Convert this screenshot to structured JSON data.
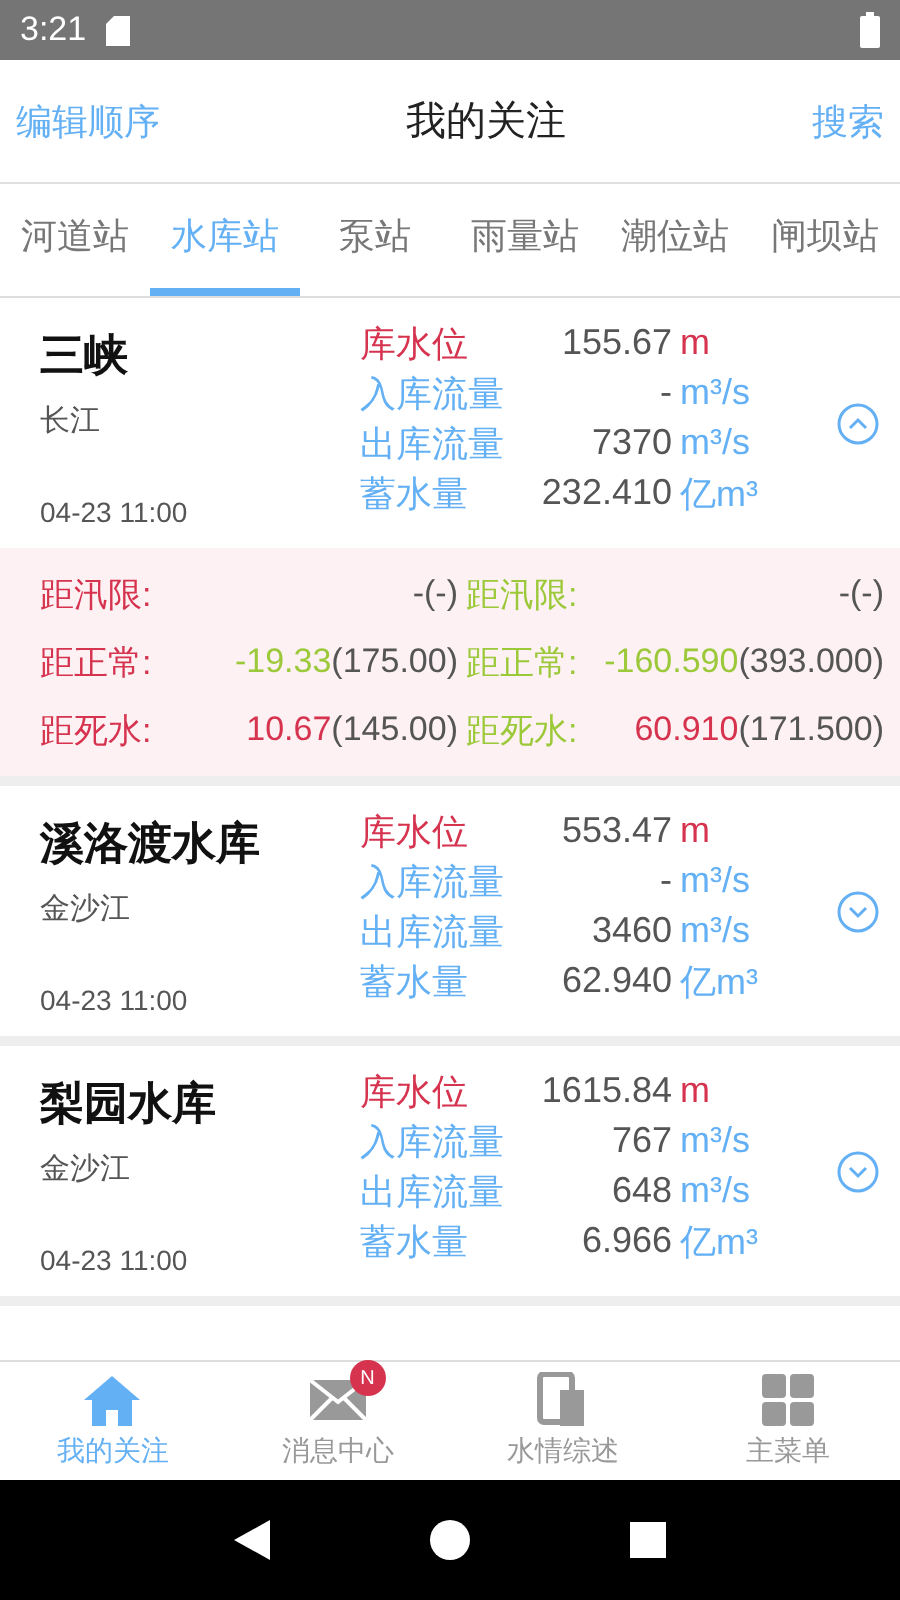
{
  "status_bar": {
    "time": "3:21"
  },
  "header": {
    "left_action": "编辑顺序",
    "title": "我的关注",
    "right_action": "搜索"
  },
  "tabs": [
    {
      "label": "河道站",
      "selected": false
    },
    {
      "label": "水库站",
      "selected": true
    },
    {
      "label": "泵站",
      "selected": false
    },
    {
      "label": "雨量站",
      "selected": false
    },
    {
      "label": "潮位站",
      "selected": false
    },
    {
      "label": "闸坝站",
      "selected": false
    }
  ],
  "stations": [
    {
      "name": "三峡",
      "river": "长江",
      "time": "04-23 11:00",
      "expanded": true,
      "metrics": [
        {
          "kind": "level",
          "label": "库水位",
          "value": "155.67",
          "unit": "m"
        },
        {
          "kind": "flow",
          "label": "入库流量",
          "value": "-",
          "unit": "m³/s"
        },
        {
          "kind": "flow",
          "label": "出库流量",
          "value": "7370",
          "unit": "m³/s"
        },
        {
          "kind": "storage",
          "label": "蓄水量",
          "value": "232.410",
          "unit": "亿m³"
        }
      ],
      "details": [
        {
          "color": "#d6334f",
          "rows": [
            {
              "label": "距汛限:",
              "value": "-",
              "color": "#555555",
              "ref": "(-)"
            },
            {
              "label": "距正常:",
              "value": "-19.33",
              "color": "#9cc93a",
              "ref": "(175.00)"
            },
            {
              "label": "距死水:",
              "value": "10.67",
              "color": "#d6334f",
              "ref": "(145.00)"
            }
          ]
        },
        {
          "color": "#9cc93a",
          "rows": [
            {
              "label": "距汛限:",
              "value": "-",
              "color": "#555555",
              "ref": "(-)"
            },
            {
              "label": "距正常:",
              "value": "-160.590",
              "color": "#9cc93a",
              "ref": "(393.000)"
            },
            {
              "label": "距死水:",
              "value": "60.910",
              "color": "#d6334f",
              "ref": "(171.500)"
            }
          ]
        }
      ]
    },
    {
      "name": "溪洛渡水库",
      "river": "金沙江",
      "time": "04-23 11:00",
      "expanded": false,
      "metrics": [
        {
          "kind": "level",
          "label": "库水位",
          "value": "553.47",
          "unit": "m"
        },
        {
          "kind": "flow",
          "label": "入库流量",
          "value": "-",
          "unit": "m³/s"
        },
        {
          "kind": "flow",
          "label": "出库流量",
          "value": "3460",
          "unit": "m³/s"
        },
        {
          "kind": "storage",
          "label": "蓄水量",
          "value": "62.940",
          "unit": "亿m³"
        }
      ]
    },
    {
      "name": "梨园水库",
      "river": "金沙江",
      "time": "04-23 11:00",
      "expanded": false,
      "metrics": [
        {
          "kind": "level",
          "label": "库水位",
          "value": "1615.84",
          "unit": "m"
        },
        {
          "kind": "flow",
          "label": "入库流量",
          "value": "767",
          "unit": "m³/s"
        },
        {
          "kind": "flow",
          "label": "出库流量",
          "value": "648",
          "unit": "m³/s"
        },
        {
          "kind": "storage",
          "label": "蓄水量",
          "value": "6.966",
          "unit": "亿m³"
        }
      ]
    }
  ],
  "bottom_nav": [
    {
      "label": "我的关注",
      "selected": true
    },
    {
      "label": "消息中心",
      "selected": false,
      "badge": "N"
    },
    {
      "label": "水情综述",
      "selected": false
    },
    {
      "label": "主菜单",
      "selected": false
    }
  ]
}
